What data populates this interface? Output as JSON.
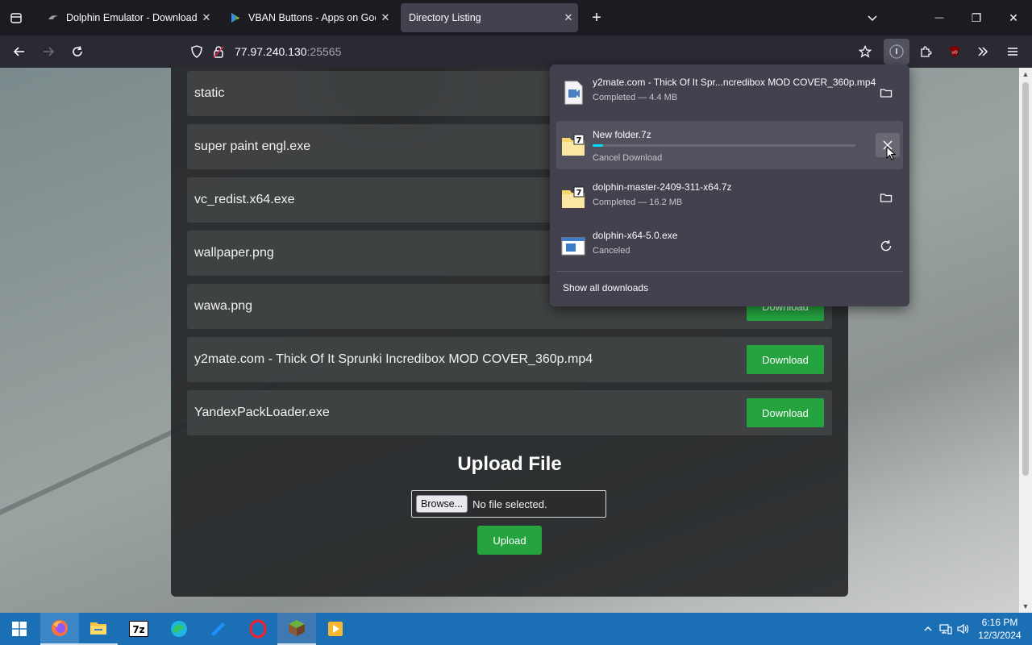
{
  "tabs": [
    {
      "title": "Dolphin Emulator - Download",
      "close": "✕"
    },
    {
      "title": "VBAN Buttons - Apps on Googl",
      "close": "✕"
    },
    {
      "title": "Directory Listing",
      "close": "✕"
    }
  ],
  "window": {
    "new_tab": "+",
    "list_tabs": "⌄",
    "minimize": "—",
    "restore": "❐",
    "close": "✕"
  },
  "url": {
    "host": "77.97.240.130",
    "port": ":25565"
  },
  "files": [
    {
      "name": "static"
    },
    {
      "name": "super paint engl.exe"
    },
    {
      "name": "vc_redist.x64.exe"
    },
    {
      "name": "wallpaper.png"
    },
    {
      "name": "wawa.png",
      "button": "Download"
    },
    {
      "name": "y2mate.com - Thick Of It Sprunki Incredibox MOD COVER_360p.mp4",
      "button": "Download"
    },
    {
      "name": "YandexPackLoader.exe",
      "button": "Download"
    }
  ],
  "upload": {
    "title": "Upload File",
    "browse": "Browse...",
    "no_file": "No file selected.",
    "button": "Upload"
  },
  "downloads": {
    "items": [
      {
        "name": "y2mate.com - Thick Of It Spr...ncredibox MOD COVER_360p.mp4",
        "status": "Completed — 4.4 MB",
        "icon": "video-file-icon",
        "action": "folder-icon"
      },
      {
        "name": "New folder.7z",
        "status": "Cancel Download",
        "progress": 0.04,
        "icon": "archive-file-icon",
        "action": "cancel-icon"
      },
      {
        "name": "dolphin-master-2409-311-x64.7z",
        "status": "Completed — 16.2 MB",
        "icon": "archive-file-icon",
        "action": "folder-icon"
      },
      {
        "name": "dolphin-x64-5.0.exe",
        "status": "Canceled",
        "icon": "exe-file-icon",
        "action": "retry-icon"
      }
    ],
    "show_all": "Show all downloads"
  },
  "taskbar": {
    "apps": [
      "firefox-icon",
      "file-explorer-icon",
      "7zip-icon",
      "edge-icon",
      "folder-app-icon",
      "opera-icon",
      "minecraft-icon",
      "media-player-icon"
    ],
    "time": "6:16 PM",
    "date": "12/3/2024"
  },
  "colors": {
    "download_green": "#24a33f",
    "progress": "#00ddff",
    "taskbar": "#1b6fb5"
  }
}
